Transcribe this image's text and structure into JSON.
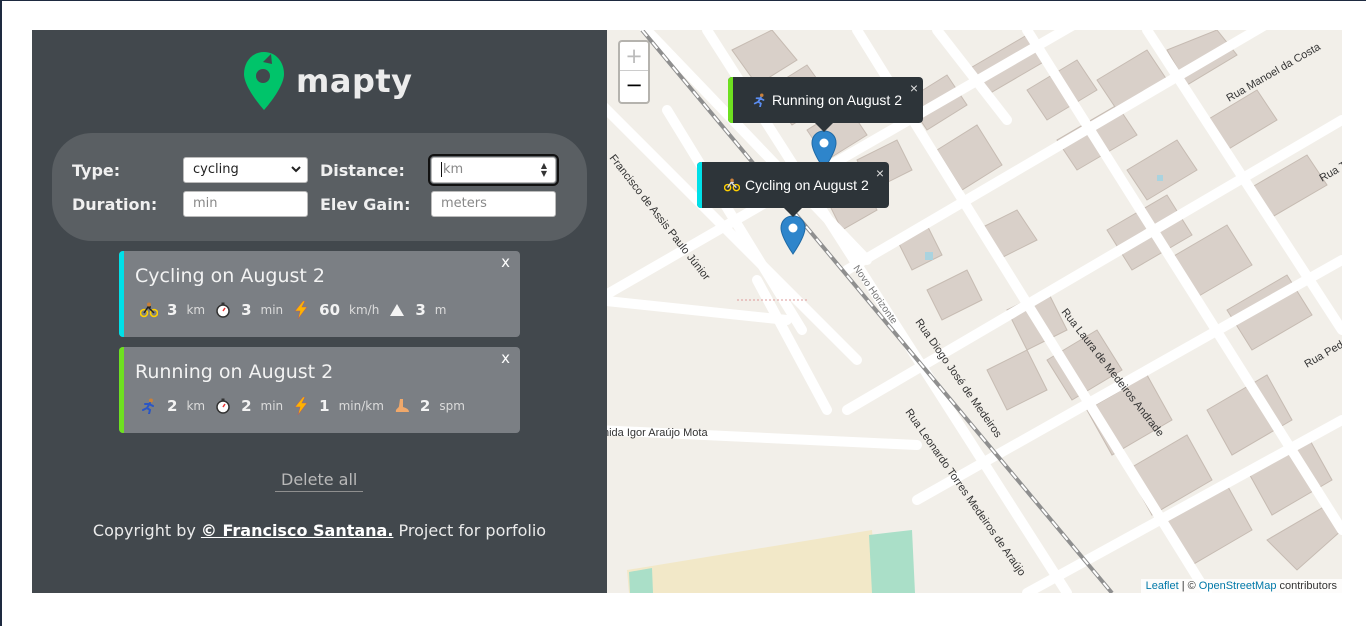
{
  "app": {
    "logo_text": "mapty",
    "brand_color": "#00c46a"
  },
  "form": {
    "type_label": "Type:",
    "type_value": "cycling",
    "distance_label": "Distance:",
    "distance_placeholder": "km",
    "duration_label": "Duration:",
    "duration_placeholder": "min",
    "elev_label": "Elev Gain:",
    "elev_placeholder": "meters"
  },
  "workouts": [
    {
      "type": "cycling",
      "accent": "#00e0e8",
      "title": "Cycling on August 2",
      "close": "x",
      "stats": [
        {
          "icon": "bike-icon",
          "value": "3",
          "unit": "km"
        },
        {
          "icon": "stopwatch-icon",
          "value": "3",
          "unit": "min"
        },
        {
          "icon": "lightning-icon",
          "value": "60",
          "unit": "km/h"
        },
        {
          "icon": "mountain-icon",
          "value": "3",
          "unit": "m"
        }
      ]
    },
    {
      "type": "running",
      "accent": "#6ee020",
      "title": "Running on August 2",
      "close": "x",
      "stats": [
        {
          "icon": "runner-icon",
          "value": "2",
          "unit": "km"
        },
        {
          "icon": "stopwatch-icon",
          "value": "2",
          "unit": "min"
        },
        {
          "icon": "lightning-icon",
          "value": "1",
          "unit": "min/km"
        },
        {
          "icon": "foot-icon",
          "value": "2",
          "unit": "spm"
        }
      ]
    }
  ],
  "delete_all": "Delete all",
  "footer": {
    "prefix": "Copyright by",
    "author": "© Francisco Santana.",
    "suffix": "Project for porfolio"
  },
  "map": {
    "zoom_in": "+",
    "zoom_out": "−",
    "popups": [
      {
        "text": "Running on August 2",
        "icon": "runner-icon",
        "close": "×",
        "accent": "#6ee020"
      },
      {
        "text": "Cycling on August 2",
        "icon": "bike-icon",
        "close": "×",
        "accent": "#00e0e8"
      }
    ],
    "streets": [
      "Rua Manoel da Costa",
      "Rua Tu",
      "Francisco de Assis Paulo Júnior",
      "Novo Horizonte",
      "Rua Diogo José de Medeiros",
      "Rua Laura de Medeiros Andrade",
      "Rua Pedr",
      "nida Igor Araújo Mota",
      "Rua Leonardo Torres Medeiros de Araújo"
    ],
    "attribution": {
      "leaflet": "Leaflet",
      "separator": "| ©",
      "osm": "OpenStreetMap",
      "suffix": "contributors"
    }
  }
}
